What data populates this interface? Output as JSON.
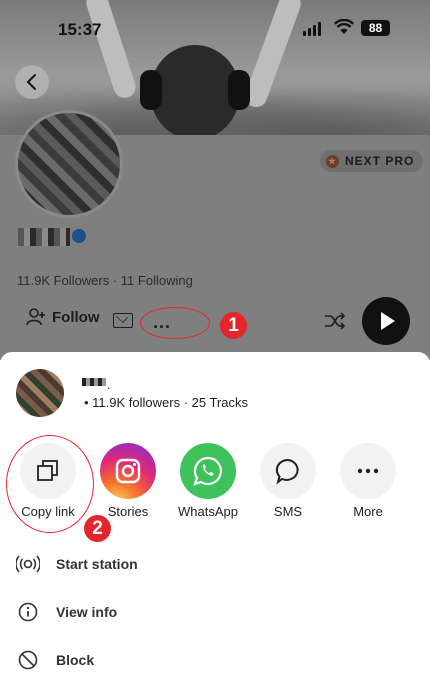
{
  "status_bar": {
    "time": "15:37",
    "battery": "88"
  },
  "profile": {
    "badge_label": "NEXT PRO",
    "followers_line": "11.9K Followers · 11 Following",
    "follow_label": "Follow",
    "more_label": "..."
  },
  "annotations": {
    "step1": "1",
    "step2": "2"
  },
  "sheet": {
    "header_name_suffix": ".",
    "meta": "•  11.9K followers · 25 Tracks",
    "share_options": [
      {
        "label": "Copy link",
        "icon": "copy-icon"
      },
      {
        "label": "Stories",
        "icon": "instagram-icon"
      },
      {
        "label": "WhatsApp",
        "icon": "whatsapp-icon"
      },
      {
        "label": "SMS",
        "icon": "sms-bubble-icon"
      },
      {
        "label": "More",
        "icon": "more-dots-icon"
      }
    ],
    "menu": [
      {
        "label": "Start station",
        "icon": "station-icon"
      },
      {
        "label": "View info",
        "icon": "info-icon"
      },
      {
        "label": "Block",
        "icon": "block-icon"
      }
    ]
  },
  "colors": {
    "annotation_red": "#e3262a",
    "whatsapp_green": "#3fc25b",
    "dim_overlay": "#7f7f7f"
  }
}
